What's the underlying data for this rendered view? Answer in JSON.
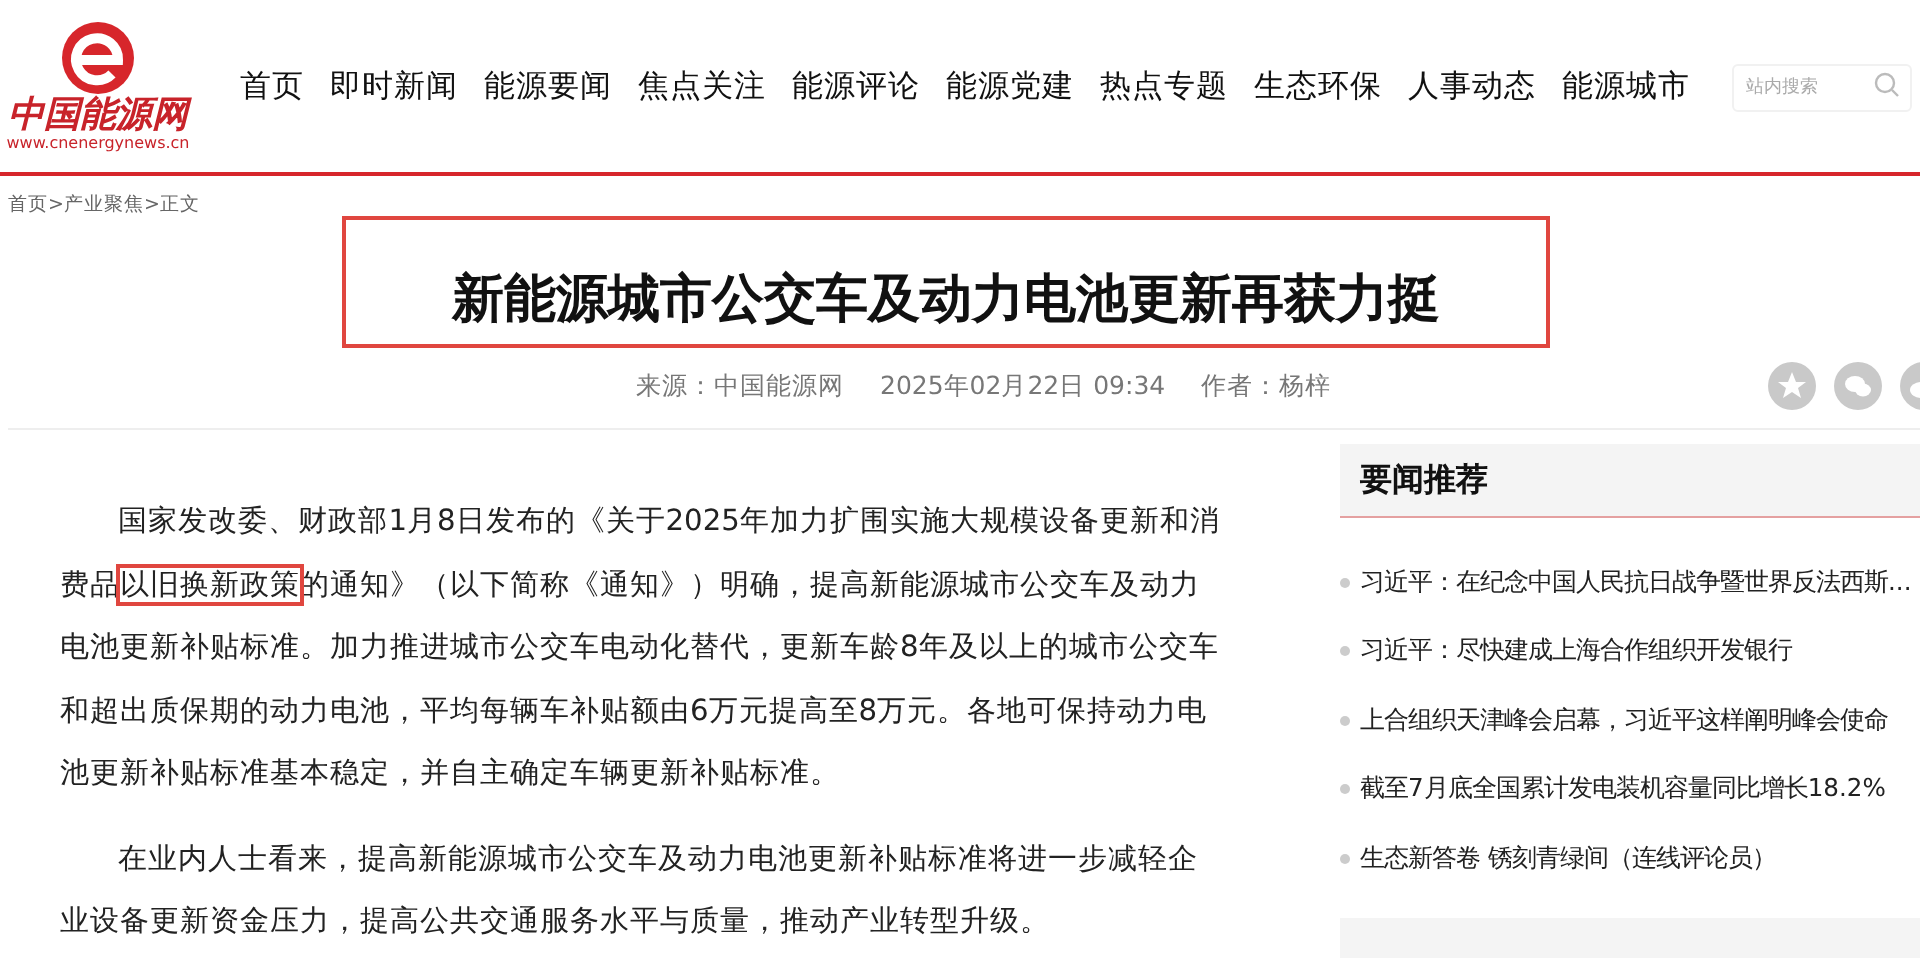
{
  "logo": {
    "name": "中国能源网",
    "url": "www.cnenergynews.cn"
  },
  "nav": [
    {
      "label": "首页"
    },
    {
      "label": "即时新闻"
    },
    {
      "label": "能源要闻"
    },
    {
      "label": "焦点关注"
    },
    {
      "label": "能源评论"
    },
    {
      "label": "能源党建"
    },
    {
      "label": "热点专题"
    },
    {
      "label": "生态环保"
    },
    {
      "label": "人事动态"
    },
    {
      "label": "能源城市"
    }
  ],
  "search": {
    "placeholder": "站内搜索"
  },
  "breadcrumb": "首页>产业聚焦>正文",
  "article": {
    "title": "新能源城市公交车及动力电池更新再获力挺",
    "title_marked": true,
    "source": "来源：中国能源网",
    "date": "2025年02月22日 09:34",
    "author": "作者：杨梓",
    "paragraphs": [
      {
        "parts": [
          {
            "text": "国家发改委、财政部1月8日发布的《关于2025年加力扩围实施大规模设备更新和消费品",
            "marked": false
          },
          {
            "text": "以旧换新政策",
            "marked": true
          },
          {
            "text": "的通知》（以下简称《通知》）明确，提高新能源城市公交车及动力电池更新补贴标准。加力推进城市公交车电动化替代，更新车龄8年及以上的城市公交车和超出质保期的动力电池，平均每辆车补贴额由6万元提高至8万元。各地可保持动力电池更新补贴标准基本稳定，并自主确定车辆更新补贴标准。",
            "marked": false
          }
        ]
      },
      {
        "parts": [
          {
            "text": "在业内人士看来，提高新能源城市公交车及动力电池更新补贴标准将进一步减轻企业设备更新资金压力，提高公共交通服务水平与质量，推动产业转型升级。",
            "marked": false
          }
        ]
      }
    ]
  },
  "sidebar": {
    "title": "要闻推荐",
    "items": [
      {
        "title": "习近平：在纪念中国人民抗日战争暨世界反法西斯..."
      },
      {
        "title": "习近平：尽快建成上海合作组织开发银行"
      },
      {
        "title": "上合组织天津峰会启幕，习近平这样阐明峰会使命"
      },
      {
        "title": "截至7月底全国累计发电装机容量同比增长18.2%"
      },
      {
        "title": "生态新答卷 锈刻青绿间（连线评论员）"
      }
    ]
  }
}
